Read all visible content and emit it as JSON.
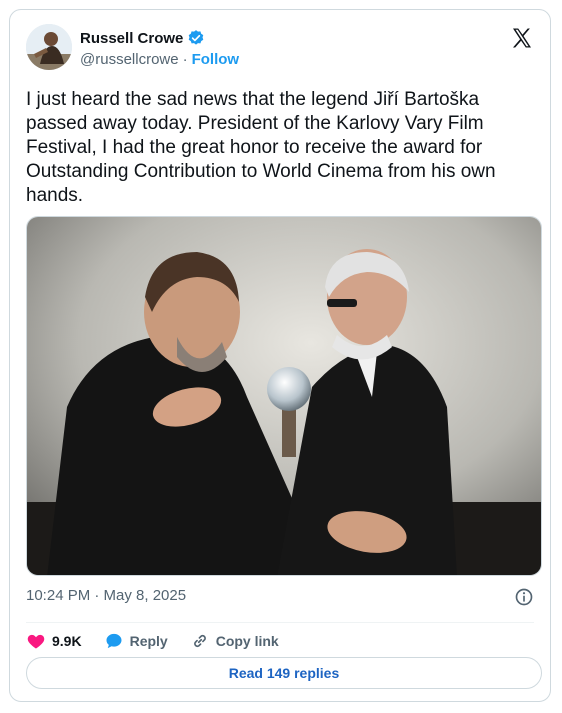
{
  "author": {
    "display_name": "Russell Crowe",
    "handle": "@russellcrowe",
    "separator": "·",
    "follow_label": "Follow",
    "verified": true
  },
  "tweet": {
    "text": "I just heard the sad news that the legend Jiří Bartoška passed away today. President of the Karlovy Vary Film Festival, I had the great honor to receive the award for Outstanding Contribution to World Cinema from his own hands.",
    "timestamp": "10:24 PM · May 8, 2025"
  },
  "actions": {
    "like_count": "9.9K",
    "reply_label": "Reply",
    "copy_label": "Copy link"
  },
  "replies_button": "Read 149 replies",
  "icons": {
    "like": "heart-icon",
    "reply": "speech-bubble-icon",
    "copy": "link-icon",
    "info": "info-circle-icon",
    "platform": "x-logo-icon",
    "verified": "verified-badge-icon"
  },
  "colors": {
    "accent": "#1d9bf0",
    "like": "#f91880",
    "text": "#0f1419",
    "muted": "#536471",
    "border": "#cfd9de"
  }
}
